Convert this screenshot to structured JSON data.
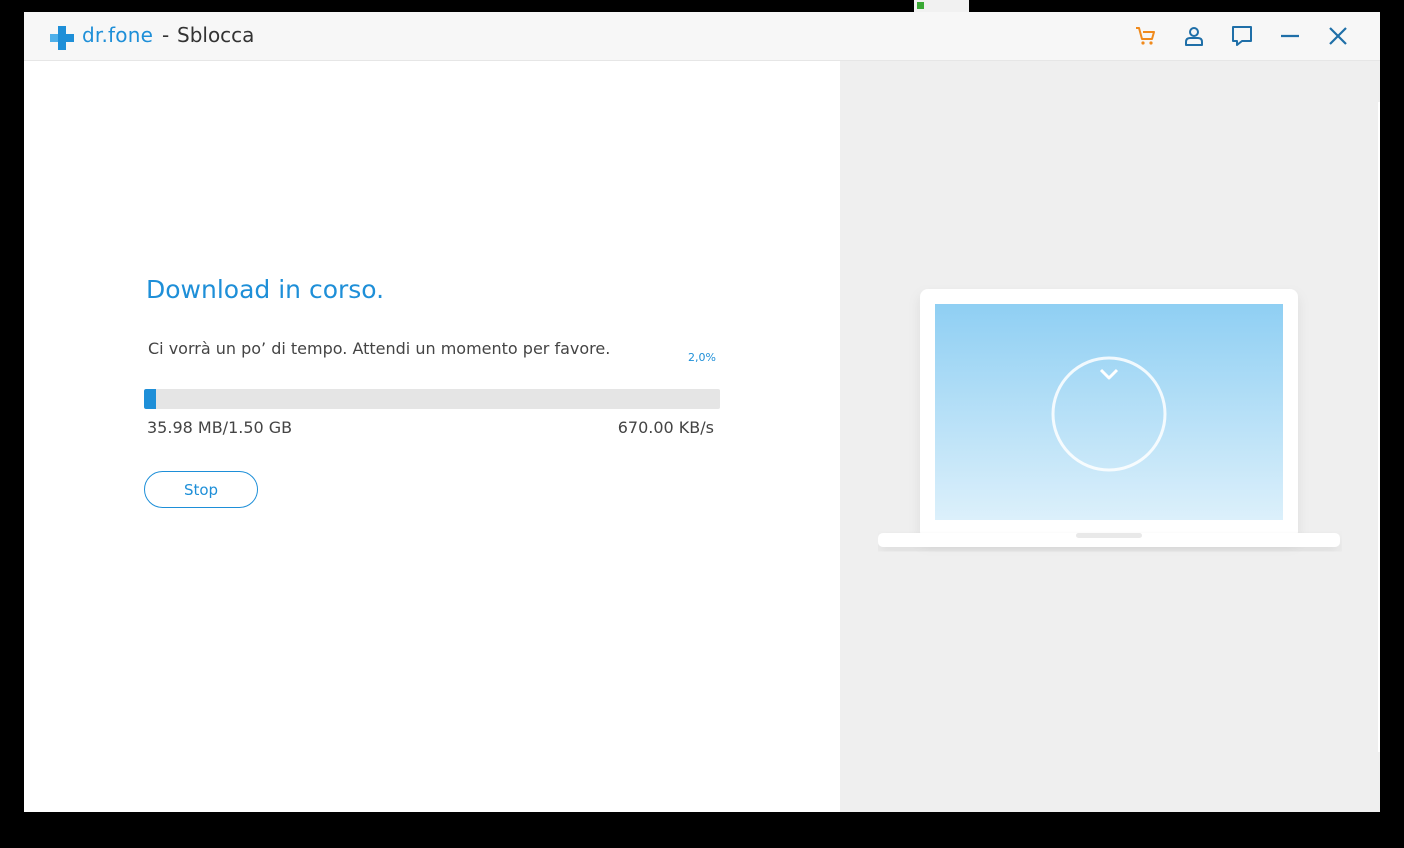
{
  "app": {
    "brand": "dr.fone",
    "separator": "-",
    "section": "Sblocca"
  },
  "toolbar": {
    "icons": [
      "cart-icon",
      "user-icon",
      "feedback-icon",
      "minimize-icon",
      "close-icon"
    ]
  },
  "download": {
    "heading": "Download in corso.",
    "subtext": "Ci vorrà un po’ di tempo. Attendi un momento per favore.",
    "percent_label": "2,0%",
    "progress_fraction": 0.02,
    "downloaded": "35.98 MB/1.50 GB",
    "speed": "670.00 KB/s",
    "stop_label": "Stop"
  },
  "colors": {
    "accent": "#1e8fd8",
    "cart": "#f08a1c",
    "icon": "#1f6fa8",
    "right_pane_bg": "#efefef"
  }
}
